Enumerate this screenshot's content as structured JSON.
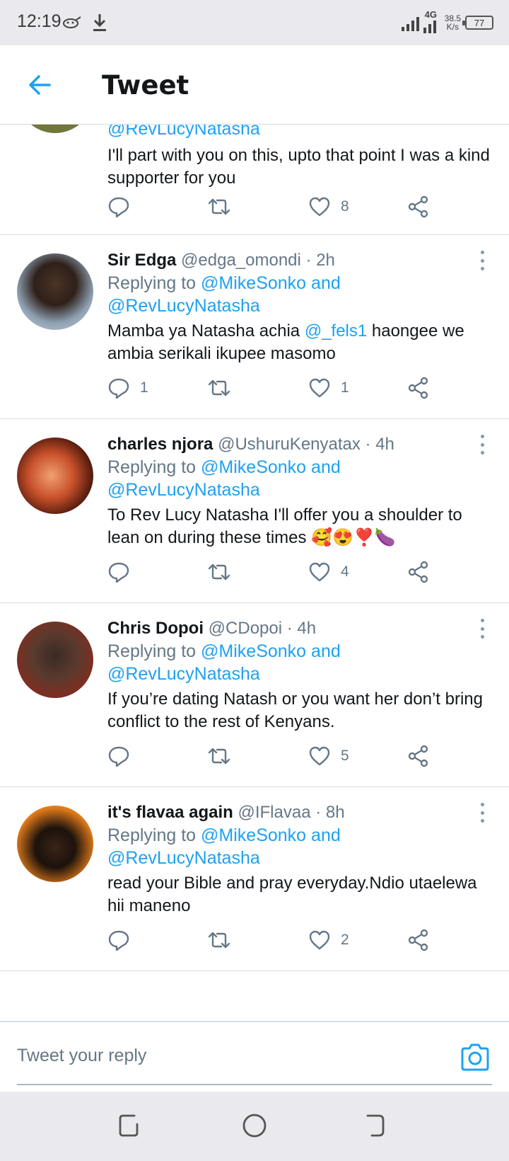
{
  "status_bar": {
    "time": "12:19",
    "network": "4G",
    "speed_value": "38.5",
    "speed_unit": "K/s",
    "battery": "77",
    "icons": [
      "cat-icon",
      "download-icon",
      "signal-icon",
      "battery-icon"
    ]
  },
  "header": {
    "title": "Tweet",
    "back_icon": "arrow-left-icon",
    "accent": "#1da1f2"
  },
  "tweets": [
    {
      "partial": true,
      "reply_mention": "@RevLucyNatasha",
      "text": "I'll part with you on this, upto that point I was a kind supporter for you",
      "reply_count": "",
      "retweet_count": "",
      "like_count": "8"
    },
    {
      "name": "Sir Edga",
      "handle": "@edga_omondi",
      "time": "· 2h",
      "replying_label": "Replying to",
      "reply_to_primary": "@MikeSonko",
      "reply_and": "and",
      "reply_to_secondary": "@RevLucyNatasha",
      "text_before": "Mamba ya Natasha achia ",
      "text_mention": "@_fels1",
      "text_after": " haongee we ambia serikali ikupee masomo",
      "reply_count": "1",
      "retweet_count": "",
      "like_count": "1"
    },
    {
      "name": "charles njora",
      "handle": "@UshuruKenyatax",
      "time": "· 4h",
      "replying_label": "Replying to",
      "reply_to_primary": "@MikeSonko",
      "reply_and": "and",
      "reply_to_secondary": "@RevLucyNatasha",
      "text": "To Rev Lucy Natasha I'll offer you a shoulder to lean on during these times 🥰😍❣️🍆",
      "reply_count": "",
      "retweet_count": "",
      "like_count": "4"
    },
    {
      "name": "Chris Dopoi",
      "handle": "@CDopoi",
      "time": "· 4h",
      "replying_label": "Replying to",
      "reply_to_primary": "@MikeSonko",
      "reply_and": "and",
      "reply_to_secondary": "@RevLucyNatasha",
      "text": "If you’re dating Natash or you want her don’t bring conflict to the rest of Kenyans.",
      "reply_count": "",
      "retweet_count": "",
      "like_count": "5"
    },
    {
      "name": "it's flavaa again",
      "handle": "@IFlavaa",
      "time": "· 8h",
      "replying_label": "Replying to",
      "reply_to_primary": "@MikeSonko",
      "reply_and": "and",
      "reply_to_secondary": "@RevLucyNatasha",
      "text": "read your Bible and pray everyday.Ndio utaelewa hii maneno",
      "reply_count": "",
      "retweet_count": "",
      "like_count": "2"
    }
  ],
  "action_icons": [
    "reply-icon",
    "retweet-icon",
    "like-icon",
    "share-icon"
  ],
  "reply_bar": {
    "placeholder": "Tweet your reply",
    "camera_icon": "camera-icon"
  },
  "nav_bar": {
    "icons": [
      "recent-apps-icon",
      "home-icon",
      "back-icon"
    ]
  }
}
